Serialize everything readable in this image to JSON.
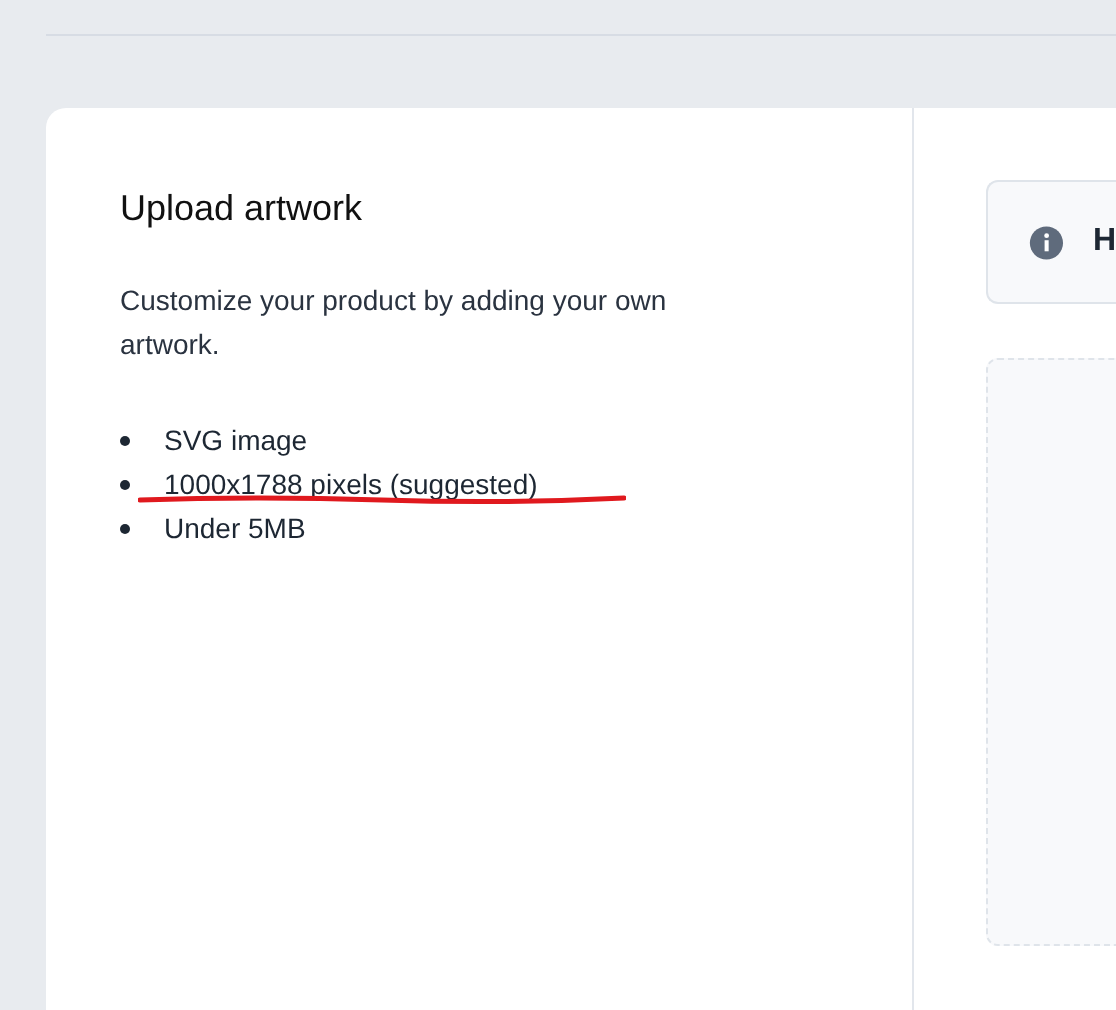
{
  "panel": {
    "title": "Upload artwork",
    "description": "Customize your product by adding your own artwork.",
    "requirements": [
      {
        "text": "SVG image",
        "underlined": false
      },
      {
        "text": "1000x1788 pixels (suggested)",
        "underlined": true
      },
      {
        "text": "Under 5MB",
        "underlined": false
      }
    ]
  },
  "info_banner": {
    "text": "H"
  },
  "drop_zone": {
    "kind": "empty"
  }
}
